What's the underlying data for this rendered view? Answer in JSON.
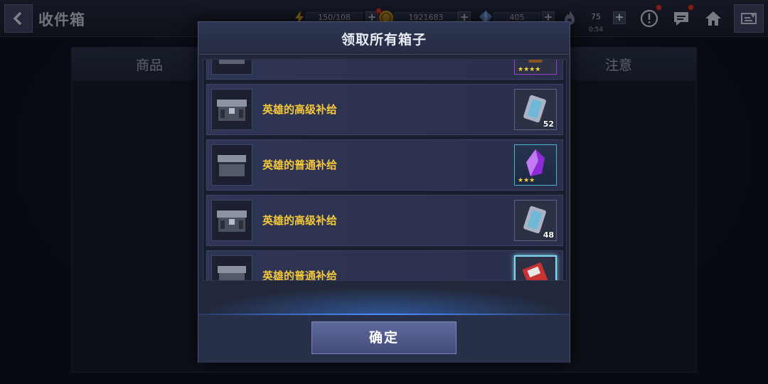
{
  "header": {
    "title": "收件箱",
    "energy": "150/108",
    "gold": "1921683",
    "crystals": "405",
    "stamina": "75",
    "stamina_timer": "0:54"
  },
  "background": {
    "tab_items": "商品",
    "tab_notes": "注意"
  },
  "modal": {
    "title": "领取所有箱子",
    "confirm_label": "确定",
    "rows": [
      {
        "name": "",
        "stars": "★★★★",
        "qty": ""
      },
      {
        "name": "英雄的高级补给",
        "stars": "",
        "qty": "52"
      },
      {
        "name": "英雄的普通补给",
        "stars": "★★★",
        "qty": ""
      },
      {
        "name": "英雄的高级补给",
        "stars": "",
        "qty": "48"
      },
      {
        "name": "英雄的普通补给",
        "stars": "",
        "qty": ""
      }
    ]
  },
  "colors": {
    "accent_gold": "#f4c83a",
    "alert_red": "#e43326",
    "glow_blue": "#4a8cff"
  }
}
